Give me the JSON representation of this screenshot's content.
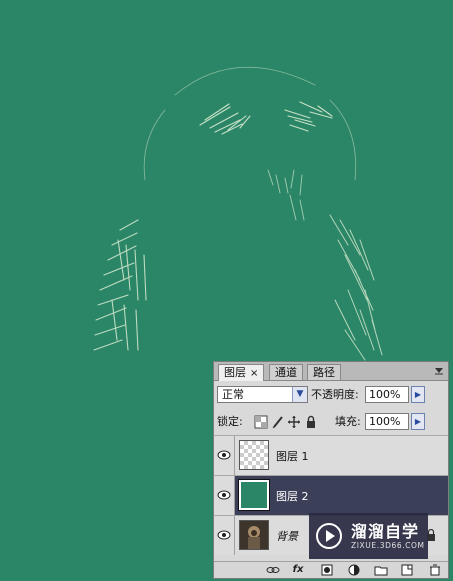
{
  "colors": {
    "canvas": "#2b8667",
    "selected_row": "#3c3f58",
    "fur": "#d7ead0"
  },
  "panel": {
    "tabs": [
      {
        "label": "图层",
        "close": "×",
        "active": true
      },
      {
        "label": "通道",
        "active": false
      },
      {
        "label": "路径",
        "active": false
      }
    ],
    "blend_mode": "正常",
    "opacity_label": "不透明度:",
    "opacity_value": "100%",
    "lock_label": "锁定:",
    "fill_label": "填充:",
    "fill_value": "100%",
    "layers": [
      {
        "name": "图层 1",
        "thumb": "transparent",
        "visible": true,
        "selected": false
      },
      {
        "name": "图层 2",
        "thumb": "green-fill",
        "visible": true,
        "selected": true
      },
      {
        "name": "背景",
        "thumb": "monkey-photo",
        "visible": true,
        "selected": false,
        "locked": true
      }
    ],
    "bottom_icons": [
      "link-icon",
      "fx-icon",
      "mask-icon",
      "adjustment-icon",
      "folder-icon",
      "new-layer-icon",
      "trash-icon"
    ],
    "fx_label": "fx"
  },
  "watermark": {
    "brand": "溜溜自学",
    "url": "ZIXUE.3D66.COM"
  }
}
